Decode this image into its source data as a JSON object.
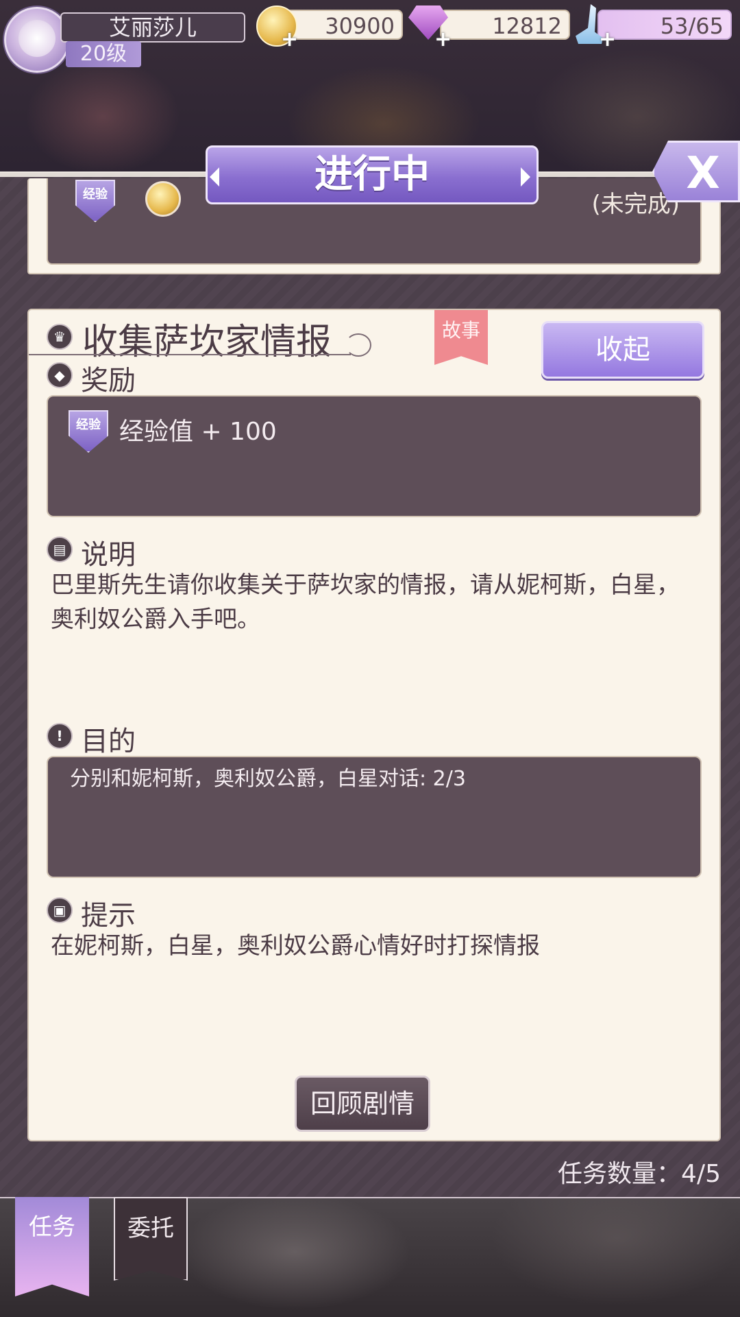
{
  "player": {
    "name": "艾丽莎儿",
    "level": "20级"
  },
  "resources": {
    "gold": "30900",
    "gems": "12812",
    "stamina": "53/65"
  },
  "header": {
    "title": "进行中",
    "close_label": "X"
  },
  "previous_quest": {
    "badge_label": "经验",
    "status": "(未完成)"
  },
  "quest": {
    "title": "收集萨坎家情报",
    "tag": "故事",
    "collapse_label": "收起",
    "reward_label": "奖励",
    "reward_badge": "经验",
    "reward_text": "经验值 + 100",
    "description_label": "说明",
    "description_text": "巴里斯先生请你收集关于萨坎家的情报，请从妮柯斯，白星，奥利奴公爵入手吧。",
    "goal_label": "目的",
    "goal_text": "分别和妮柯斯，奥利奴公爵，白星对话: 2/3",
    "hint_label": "提示",
    "hint_text": "在妮柯斯，白星，奥利奴公爵心情好时打探情报",
    "review_label": "回顾剧情"
  },
  "task_count": "任务数量：4/5",
  "tabs": [
    {
      "label": "任务"
    },
    {
      "label": "委托"
    }
  ],
  "colors": {
    "accent_purple": "#8a6fd0",
    "story_tag": "#ef8a90",
    "panel_cream": "#faf4ea",
    "dark_box": "#5e4e58"
  }
}
